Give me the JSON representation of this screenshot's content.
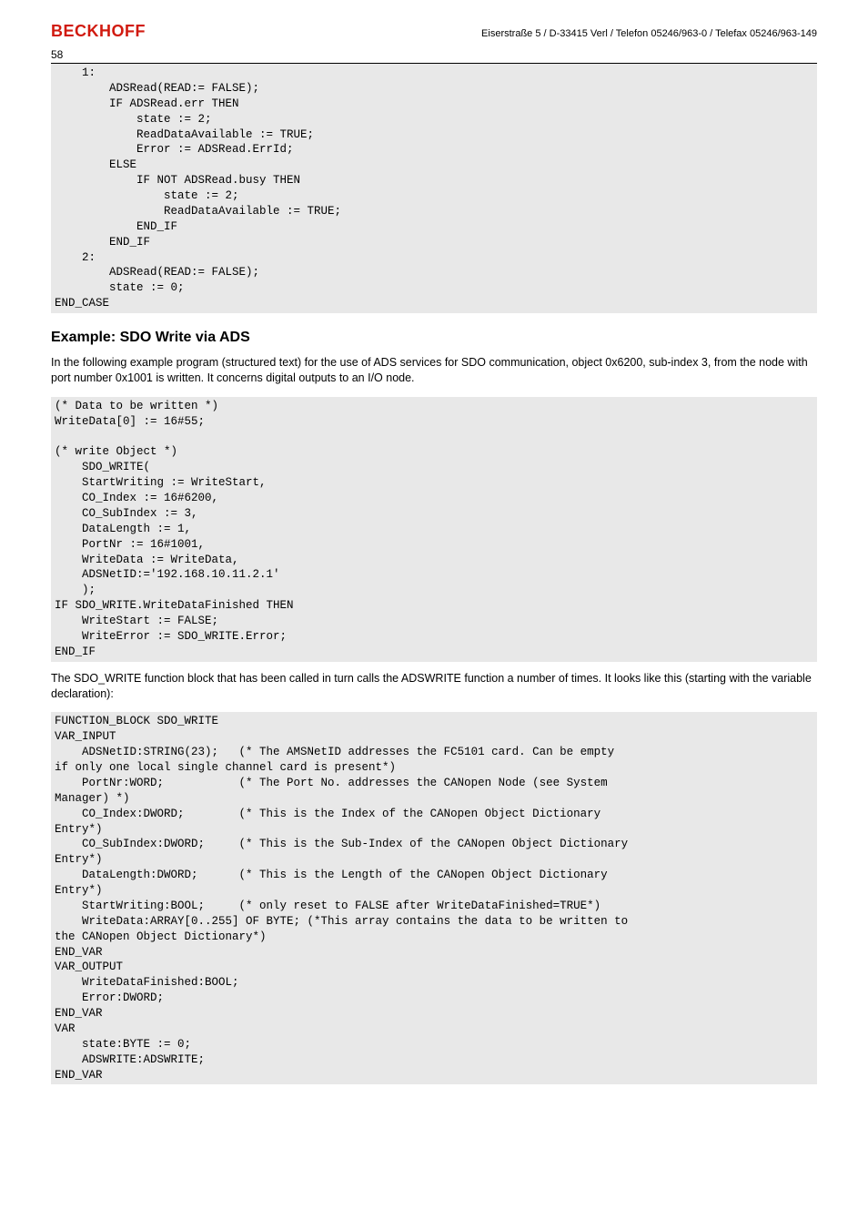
{
  "header": {
    "brand": "BECKHOFF",
    "info": "Eiserstraße 5 / D-33415 Verl / Telefon 05246/963-0 / Telefax 05246/963-149",
    "page_number": "58"
  },
  "code1": "    1:\n        ADSRead(READ:= FALSE);\n        IF ADSRead.err THEN\n            state := 2;\n            ReadDataAvailable := TRUE;\n            Error := ADSRead.ErrId;\n        ELSE\n            IF NOT ADSRead.busy THEN\n                state := 2;\n                ReadDataAvailable := TRUE;\n            END_IF\n        END_IF\n    2:\n        ADSRead(READ:= FALSE);\n        state := 0;\nEND_CASE",
  "heading1": "Example: SDO Write via ADS",
  "para1": "In the following example program (structured text) for the use of ADS services for SDO communication, object 0x6200, sub-index 3, from the node with port number 0x1001 is written. It concerns digital outputs to an I/O node.",
  "code2": "(* Data to be written *)\nWriteData[0] := 16#55;\n\n(* write Object *)\n    SDO_WRITE(\n    StartWriting := WriteStart,\n    CO_Index := 16#6200,\n    CO_SubIndex := 3,\n    DataLength := 1,\n    PortNr := 16#1001,\n    WriteData := WriteData,\n    ADSNetID:='192.168.10.11.2.1'\n    );\nIF SDO_WRITE.WriteDataFinished THEN\n    WriteStart := FALSE;\n    WriteError := SDO_WRITE.Error;\nEND_IF",
  "para2": "The SDO_WRITE function block that has been called in turn calls the ADSWRITE function a number of times. It looks like this (starting with the variable declaration):",
  "code3": "FUNCTION_BLOCK SDO_WRITE\nVAR_INPUT\n    ADSNetID:STRING(23);   (* The AMSNetID addresses the FC5101 card. Can be empty\nif only one local single channel card is present*)\n    PortNr:WORD;           (* The Port No. addresses the CANopen Node (see System\nManager) *)\n    CO_Index:DWORD;        (* This is the Index of the CANopen Object Dictionary\nEntry*)\n    CO_SubIndex:DWORD;     (* This is the Sub-Index of the CANopen Object Dictionary\nEntry*)\n    DataLength:DWORD;      (* This is the Length of the CANopen Object Dictionary\nEntry*)\n    StartWriting:BOOL;     (* only reset to FALSE after WriteDataFinished=TRUE*)\n    WriteData:ARRAY[0..255] OF BYTE; (*This array contains the data to be written to\nthe CANopen Object Dictionary*)\nEND_VAR\nVAR_OUTPUT\n    WriteDataFinished:BOOL;\n    Error:DWORD;\nEND_VAR\nVAR\n    state:BYTE := 0;\n    ADSWRITE:ADSWRITE;\nEND_VAR"
}
